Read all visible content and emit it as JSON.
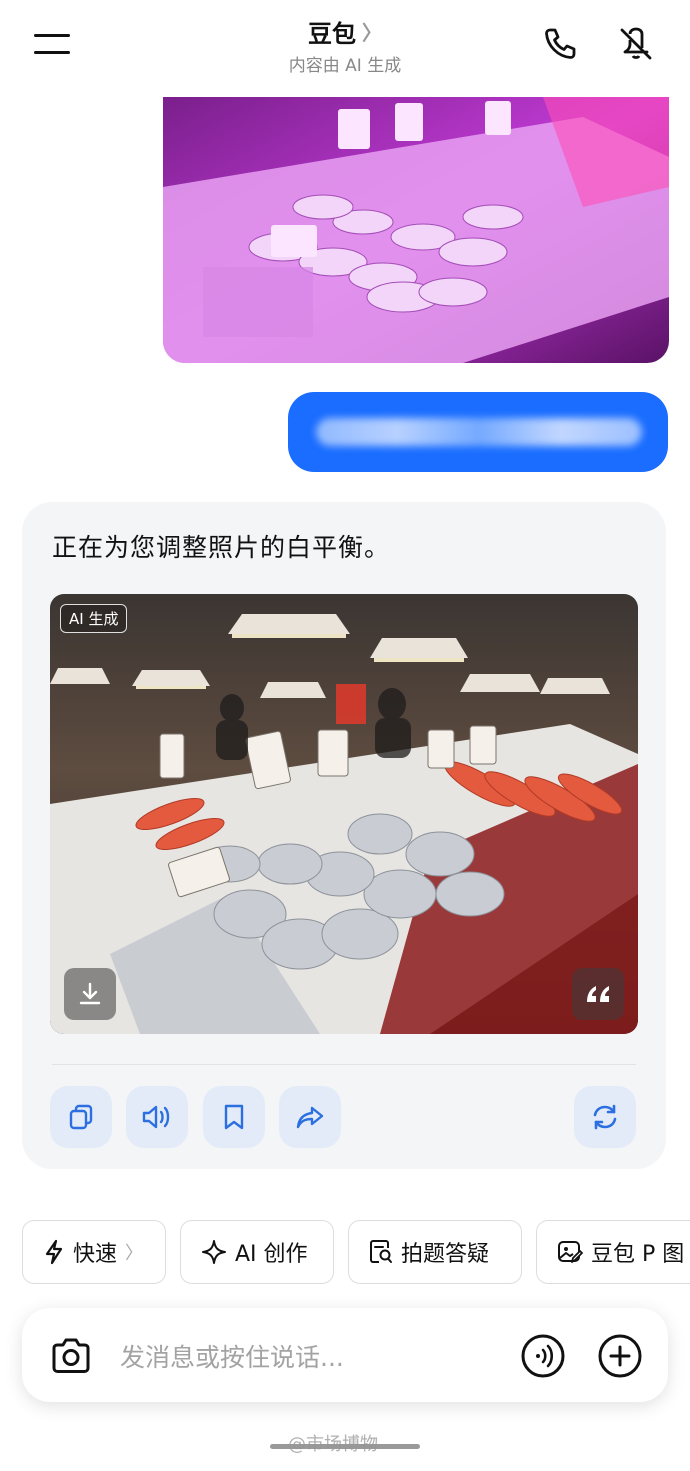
{
  "header": {
    "title": "豆包",
    "title_chevron": "〉",
    "subtitle": "内容由 AI 生成",
    "icons": [
      "menu-icon",
      "phone-icon",
      "mute-icon"
    ]
  },
  "chat": {
    "reply_text": "正在为您调整照片的白平衡。",
    "ai_badge": "AI 生成",
    "image_actions": [
      "download-icon",
      "quote-icon"
    ],
    "actions": [
      "copy-icon",
      "speaker-icon",
      "bookmark-icon",
      "share-icon",
      "regenerate-icon"
    ]
  },
  "chips": [
    {
      "label": "快速",
      "icon": "lightning-icon",
      "chevron": "〉"
    },
    {
      "label": "AI 创作",
      "icon": "sparkle-icon"
    },
    {
      "label": "拍题答疑",
      "icon": "doc-search-icon"
    },
    {
      "label": "豆包 P 图",
      "icon": "image-edit-icon"
    }
  ],
  "input": {
    "placeholder": "发消息或按住说话..."
  },
  "watermark": "@市场博物",
  "colors": {
    "accent": "#1a6dff",
    "icon_blue": "#2c6fe0",
    "card_bg": "#f4f5f7"
  }
}
